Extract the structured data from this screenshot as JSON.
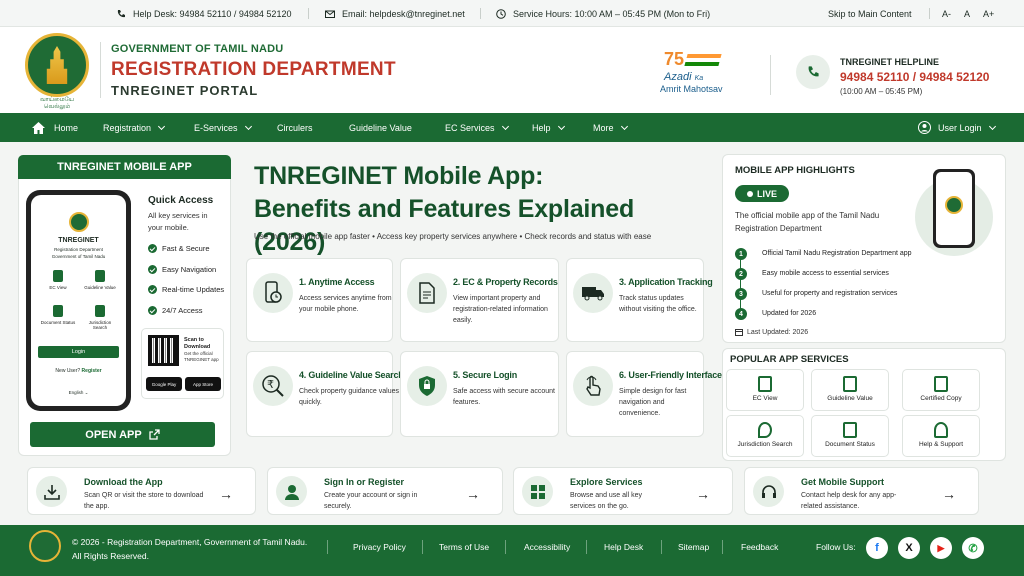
{
  "topbar": {
    "helpdesk": "Help Desk: 94984 52110 / 94984 52120",
    "email": "Email: helpdesk@tnreginet.net",
    "hours": "Service Hours: 10:00 AM – 05:45 PM (Mon to Fri)",
    "skip": "Skip to Main Content",
    "font_minus": "A-",
    "font_normal": "A",
    "font_plus": "A+"
  },
  "header": {
    "gov": "GOVERNMENT OF TAMIL NADU",
    "dept": "REGISTRATION DEPARTMENT",
    "portal": "TNREGINET PORTAL",
    "emblem_caption": "வாய்மையே வெல்லும்",
    "azadi_75": "75",
    "azadi_line1": "Azadi",
    "azadi_ka": "Ka",
    "azadi_line2": "Amrit Mahotsav",
    "helpline_title": "TNREGINET HELPLINE",
    "helpline_numbers": "94984 52110 / 94984 52120",
    "helpline_hours": "(10:00 AM – 05:45 PM)"
  },
  "nav": {
    "home": "Home",
    "registration": "Registration",
    "eservices": "E-Services",
    "circulers": "Circulers",
    "guideline": "Guideline Value",
    "ec": "EC Services",
    "help": "Help",
    "more": "More",
    "login": "User Login"
  },
  "left": {
    "title": "TNREGINET MOBILE APP",
    "phone_title": "TNREGINET",
    "phone_sub1": "Registration Department",
    "phone_sub2": "Government of Tamil Nadu",
    "grid": [
      "EC View",
      "Guideline Value",
      "Document Status",
      "Jurisdiction Search"
    ],
    "login": "Login",
    "newuser": "New User?",
    "register": "Register",
    "lang": "English",
    "qa_title": "Quick Access",
    "qa_desc": "All key services in your mobile.",
    "qa_items": [
      "Fast & Secure",
      "Easy Navigation",
      "Real-time Updates",
      "24/7 Access"
    ],
    "scan_title": "Scan to Download",
    "scan_desc": "Get the official TNREGINET app",
    "google": "Google Play",
    "apple": "App Store",
    "open_app": "OPEN APP"
  },
  "main": {
    "title_line1": "TNREGINET Mobile App:",
    "title_line2": "Benefits and Features Explained (2026)",
    "subtitle": "Use the official mobile app faster  •  Access key property services anywhere  •  Check records and status with ease",
    "features": [
      {
        "title": "1. Anytime Access",
        "desc": "Access services anytime from your mobile phone."
      },
      {
        "title": "2. EC & Property Records",
        "desc": "View important property and registration-related information easily."
      },
      {
        "title": "3. Application Tracking",
        "desc": "Track status updates without visiting the office."
      },
      {
        "title": "4. Guideline Value Search",
        "desc": "Check property guidance values quickly."
      },
      {
        "title": "5. Secure Login",
        "desc": "Safe access with secure account features."
      },
      {
        "title": "6. User-Friendly Interface",
        "desc": "Simple design for fast navigation and convenience."
      }
    ]
  },
  "highlights": {
    "title": "MOBILE APP HIGHLIGHTS",
    "live": "LIVE",
    "desc": "The official mobile app of the Tamil Nadu Registration Department",
    "items": [
      {
        "n": "1",
        "t": "Official Tamil Nadu Registration Department app"
      },
      {
        "n": "2",
        "t": "Easy mobile access to essential services"
      },
      {
        "n": "3",
        "t": "Useful for property and registration services"
      },
      {
        "n": "4",
        "t": "Updated for 2026"
      }
    ],
    "updated": "Last Updated: 2026"
  },
  "popular": {
    "title": "POPULAR APP SERVICES",
    "items": [
      "EC View",
      "Guideline Value",
      "Certified Copy",
      "Jurisdiction Search",
      "Document Status",
      "Help & Support"
    ]
  },
  "actions": [
    {
      "title": "Download the App",
      "desc": "Scan QR or visit the store to download the app."
    },
    {
      "title": "Sign In or Register",
      "desc": "Create your account or sign in securely."
    },
    {
      "title": "Explore Services",
      "desc": "Browse and use all key services on the go."
    },
    {
      "title": "Get Mobile Support",
      "desc": "Contact help desk for any app-related assistance."
    }
  ],
  "footer": {
    "copy1": "© 2026 - Registration Department, Government of Tamil Nadu.",
    "copy2": "All Rights Reserved.",
    "links": [
      "Privacy Policy",
      "Terms of Use",
      "Accessibility",
      "Help Desk",
      "Sitemap",
      "Feedback"
    ],
    "follow": "Follow Us:",
    "social": [
      "f",
      "X",
      "▶",
      "✆"
    ]
  },
  "colors": {
    "primary_green": "#1b6a33",
    "accent_red": "#c0392b"
  }
}
